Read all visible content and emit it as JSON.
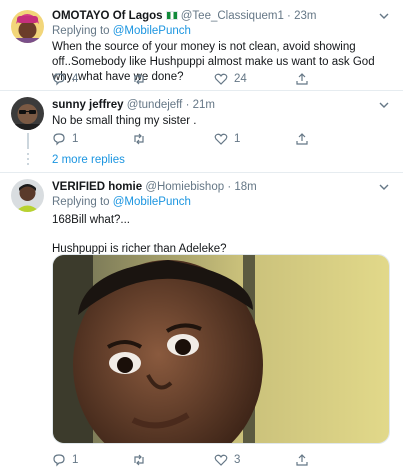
{
  "tweets": [
    {
      "name": "OMOTAYO Of Lagos",
      "handle": "@Tee_Classiquem1",
      "dot": "·",
      "time": "23m",
      "replying_label": "Replying to",
      "replying_to": "@MobilePunch",
      "text": "When the source of your money is not clean, avoid showing off..Somebody like Hushpuppi almost make us want to ask God why, what have we done?",
      "replies": "4",
      "retweets": "",
      "likes": "24"
    },
    {
      "name": "sunny jeffrey",
      "handle": "@tundejeff",
      "dot": "·",
      "time": "21m",
      "text": "No be small thing my sister .",
      "replies": "1",
      "retweets": "",
      "likes": "1"
    },
    {
      "name": "VERIFIED homie",
      "handle": "@Homiebishop",
      "dot": "·",
      "time": "18m",
      "replying_label": "Replying to",
      "replying_to": "@MobilePunch",
      "text_line1": "168Bill what?...",
      "text_line2": "Hushpuppi is richer than Adeleke?",
      "replies": "1",
      "retweets": "",
      "likes": "3"
    }
  ],
  "more_replies": "2 more replies",
  "icons": {
    "reply": "reply-icon",
    "retweet": "retweet-icon",
    "like": "heart-icon",
    "share": "share-icon",
    "caret": "chevron-down-icon"
  },
  "colors": {
    "link": "#1b95e0",
    "muted": "#657786",
    "text": "#14171a",
    "divider": "#e6ecf0"
  }
}
